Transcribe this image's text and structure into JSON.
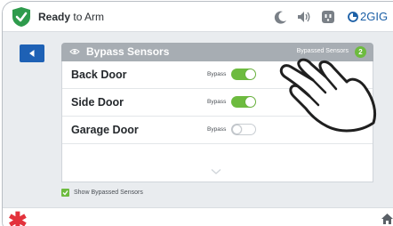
{
  "status": {
    "state_bold": "Ready",
    "state_rest": " to Arm",
    "brand": "2GIG",
    "icons": [
      "moon-icon",
      "speaker-icon",
      "outlet-icon",
      "brand-logo-icon"
    ],
    "colors": {
      "ready_green": "#2e9b4c",
      "brand_blue": "#1b5fa6"
    }
  },
  "panel": {
    "title": "Bypass Sensors",
    "bypassed_label": "Bypassed Sensors",
    "bypassed_count": "2",
    "header_color": "#a7adb3"
  },
  "sensors": [
    {
      "name": "Back Door",
      "bypass_label": "Bypass",
      "bypassed": true
    },
    {
      "name": "Side Door",
      "bypass_label": "Bypass",
      "bypassed": true
    },
    {
      "name": "Garage Door",
      "bypass_label": "Bypass",
      "bypassed": false
    }
  ],
  "footer": {
    "show_bypassed_label": "Show Bypassed Sensors",
    "show_bypassed_checked": true
  },
  "colors": {
    "toggle_on": "#6dbb3f",
    "back_button": "#1e61b5",
    "emergency": "#e3323c"
  }
}
